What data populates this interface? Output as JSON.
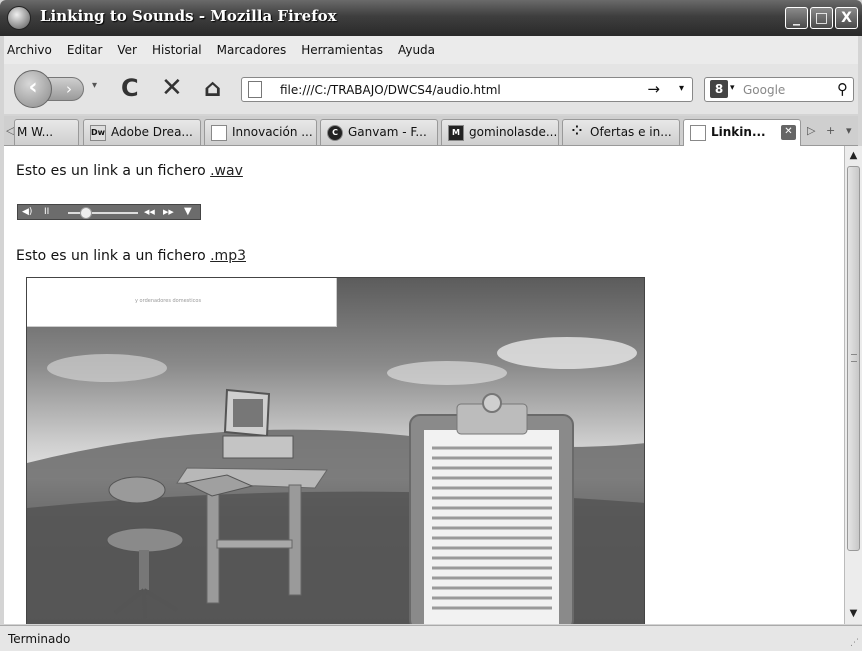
{
  "window": {
    "title": "Linking to Sounds - Mozilla Firefox",
    "min": "_",
    "max": "□",
    "close": "X"
  },
  "menu": [
    "Archivo",
    "Editar",
    "Ver",
    "Historial",
    "Marcadores",
    "Herramientas",
    "Ayuda"
  ],
  "nav": {
    "back": "‹",
    "forward": "›",
    "history_dd": "▾",
    "reload": "C",
    "stop": "✕",
    "home": "⌂",
    "url": "file:///C:/TRABAJO/DWCS4/audio.html",
    "go": "→",
    "url_dd": "▾",
    "search_engine_icon": "8",
    "search_dd": "▾",
    "search_placeholder": "Google",
    "search_icon": "⚲"
  },
  "tabs": [
    {
      "label": "M W...",
      "icon": ""
    },
    {
      "label": "Adobe Drea...",
      "icon": "Dw"
    },
    {
      "label": "Innovación ...",
      "icon": ""
    },
    {
      "label": "Ganvam - F...",
      "icon": "C"
    },
    {
      "label": "gominolasde...",
      "icon": "M"
    },
    {
      "label": "Ofertas e in...",
      "icon": ""
    },
    {
      "label": "Linkin...",
      "icon": "",
      "active": true
    }
  ],
  "tabctl": {
    "left": "◁",
    "right": "▷",
    "new": "+",
    "list": "▾"
  },
  "page": {
    "para1_text": "Esto es un link a un fichero ",
    "para1_link": ".wav",
    "para2_text": "Esto es un link a un fichero ",
    "para2_link": ".mp3",
    "player": {
      "vol": "◀)",
      "pause": "II",
      "prev": "◀◀",
      "next": "▶▶",
      "menu": "▼",
      "position": 0.25
    },
    "image_caption": "y ordenadores domesticos"
  },
  "scroll": {
    "up": "▲",
    "down": "▼"
  },
  "status": "Terminado"
}
